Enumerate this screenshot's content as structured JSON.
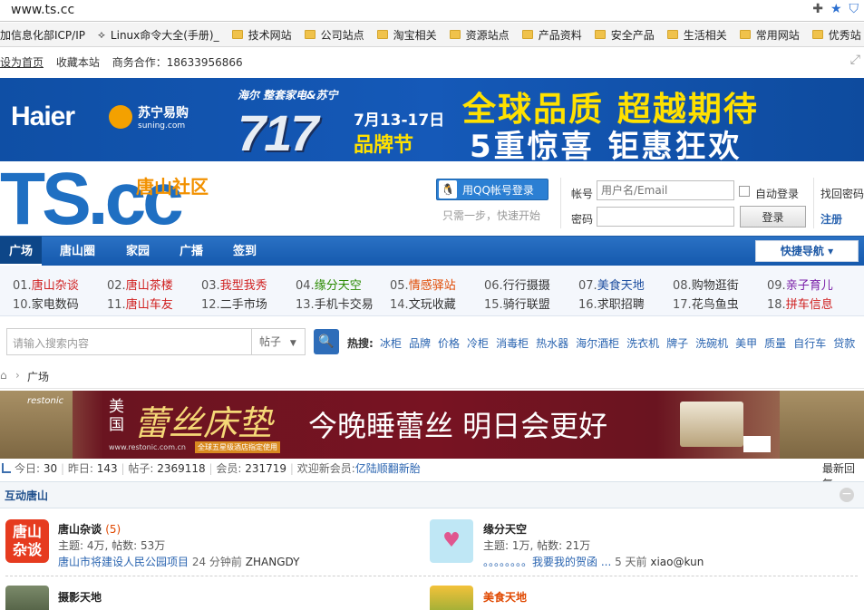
{
  "browser": {
    "url": "www.ts.cc",
    "bookmarks": [
      {
        "label": "加信息化部ICP/IP",
        "type": "page"
      },
      {
        "label": "Linux命令大全(手册)_",
        "type": "page"
      },
      {
        "label": "技术网站",
        "type": "folder"
      },
      {
        "label": "公司站点",
        "type": "folder"
      },
      {
        "label": "淘宝相关",
        "type": "folder"
      },
      {
        "label": "资源站点",
        "type": "folder"
      },
      {
        "label": "产品资料",
        "type": "folder"
      },
      {
        "label": "安全产品",
        "type": "folder"
      },
      {
        "label": "生活相关",
        "type": "folder"
      },
      {
        "label": "常用网站",
        "type": "folder"
      },
      {
        "label": "优秀站",
        "type": "folder"
      }
    ]
  },
  "toplinks": {
    "set_home": "设为首页",
    "bookmark": "收藏本站",
    "business": "商务合作：18633956866"
  },
  "banner_top": {
    "haier": "Haier",
    "suning": "苏宁易购",
    "suning_domain": "suning.com",
    "promo_small": "海尔 整套家电&苏宁",
    "promo_num": "717",
    "promo_date": "7月13-17日",
    "promo_brand": "品牌节",
    "line1": "全球品质 超越期待",
    "line2": "5重惊喜 钜惠狂欢"
  },
  "header": {
    "logo": "TS.cc",
    "logo_sub": "唐山社区",
    "qq_login": "用QQ帐号登录",
    "qq_hint": "只需一步，快速开始",
    "account_label": "帐号",
    "account_placeholder": "用户名/Email",
    "password_label": "密码",
    "auto_login": "自动登录",
    "login_button": "登录",
    "find_password": "找回密码",
    "register": "注册"
  },
  "nav": {
    "items": [
      "广场",
      "唐山圈",
      "家园",
      "广播",
      "签到"
    ],
    "quick_nav": "快捷导航 ▾"
  },
  "forum_grid": [
    {
      "num": "01.",
      "name": "唐山杂谈",
      "color": "#d02020"
    },
    {
      "num": "02.",
      "name": "唐山茶楼",
      "color": "#d02020"
    },
    {
      "num": "03.",
      "name": "我型我秀",
      "color": "#d02020"
    },
    {
      "num": "04.",
      "name": "缘分天空",
      "color": "#2a8a00"
    },
    {
      "num": "05.",
      "name": "情感驿站",
      "color": "#e04800"
    },
    {
      "num": "06.",
      "name": "行行摄摄",
      "color": "#333333"
    },
    {
      "num": "07.",
      "name": "美食天地",
      "color": "#1f4fa0"
    },
    {
      "num": "08.",
      "name": "购物逛街",
      "color": "#333333"
    },
    {
      "num": "09.",
      "name": "亲子育儿",
      "color": "#7a1fa8"
    },
    {
      "num": "10.",
      "name": "家电数码",
      "color": "#333333"
    },
    {
      "num": "11.",
      "name": "唐山车友",
      "color": "#d02020"
    },
    {
      "num": "12.",
      "name": "二手市场",
      "color": "#333333"
    },
    {
      "num": "13.",
      "name": "手机卡交易",
      "color": "#333333"
    },
    {
      "num": "14.",
      "name": "文玩收藏",
      "color": "#333333"
    },
    {
      "num": "15.",
      "name": "骑行联盟",
      "color": "#333333"
    },
    {
      "num": "16.",
      "name": "求职招聘",
      "color": "#333333"
    },
    {
      "num": "17.",
      "name": "花鸟鱼虫",
      "color": "#333333"
    },
    {
      "num": "18.",
      "name": "拼车信息",
      "color": "#d02020"
    }
  ],
  "search": {
    "placeholder": "请输入搜索内容",
    "type": "帖子",
    "hot_label": "热搜:",
    "hot": [
      "冰柜",
      "品牌",
      "价格",
      "冷柜",
      "消毒柜",
      "热水器",
      "海尔酒柜",
      "洗衣机",
      "牌子",
      "洗碗机",
      "美甲",
      "质量",
      "自行车",
      "贷款"
    ]
  },
  "breadcrumb": {
    "sep": "›",
    "current": "广场"
  },
  "banner_mid": {
    "brand": "restonic",
    "us": "美国",
    "name": "蕾丝床垫",
    "slogan": "今晚睡蕾丝 明日会更好",
    "url": "www.restonic.com.cn",
    "tag": "全球五星级酒店指定使用"
  },
  "stats": {
    "today_label": "今日:",
    "today": "30",
    "yesterday_label": "昨日:",
    "yesterday": "143",
    "posts_label": "帖子:",
    "posts": "2369118",
    "members_label": "会员:",
    "members": "231719",
    "welcome_label": "欢迎新会员:",
    "newest": "亿陆顺翻新胎",
    "latest_reply": "最新回复"
  },
  "section": {
    "title": "互动唐山",
    "collapse": "−"
  },
  "forums": [
    {
      "name": "唐山杂谈",
      "today": "(5)",
      "meta": "主题: 4万, 帖数: 53万",
      "last_title": "唐山市将建设人民公园项目",
      "last_time": "24 分钟前",
      "last_user": "ZHANGDY",
      "icon": "tangshan-zatan-icon"
    },
    {
      "name": "缘分天空",
      "today": "",
      "meta": "主题: 1万, 帖数: 21万",
      "last_title": "。。。。。。。。我要我的贺函 ...",
      "last_time": "5 天前",
      "last_user": "xiao@kun",
      "icon": "love-heart-icon"
    },
    {
      "name": "摄影天地",
      "today": "",
      "meta": "",
      "last_title": "",
      "last_time": "",
      "last_user": "",
      "icon": "photographer-icon"
    },
    {
      "name": "美食天地",
      "today": "",
      "meta": "",
      "last_title": "",
      "last_time": "",
      "last_user": "",
      "icon": "food-icon"
    }
  ]
}
